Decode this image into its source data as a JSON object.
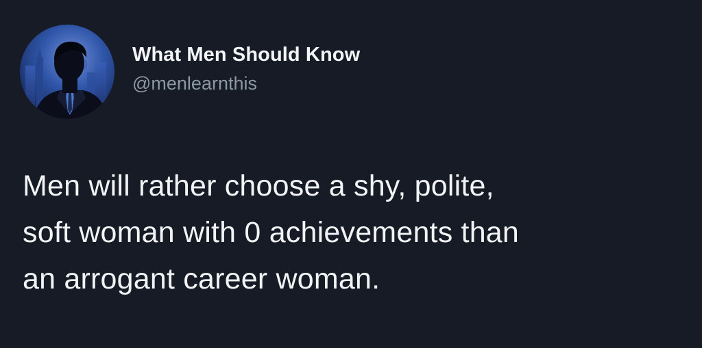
{
  "tweet": {
    "display_name": "What Men Should Know",
    "handle": "@menlearnthis",
    "text": "Men will rather choose a shy, polite,\nsoft woman with 0 achievements than\nan arrogant career woman."
  },
  "avatar": {
    "icon": "man-in-suit-silhouette-icon",
    "background_color": "#1d3f7a",
    "silhouette_color": "#0b0e1a"
  },
  "theme": {
    "background": "#161b26",
    "primary_text": "#f3f5f7",
    "secondary_text": "#8b98a5"
  }
}
